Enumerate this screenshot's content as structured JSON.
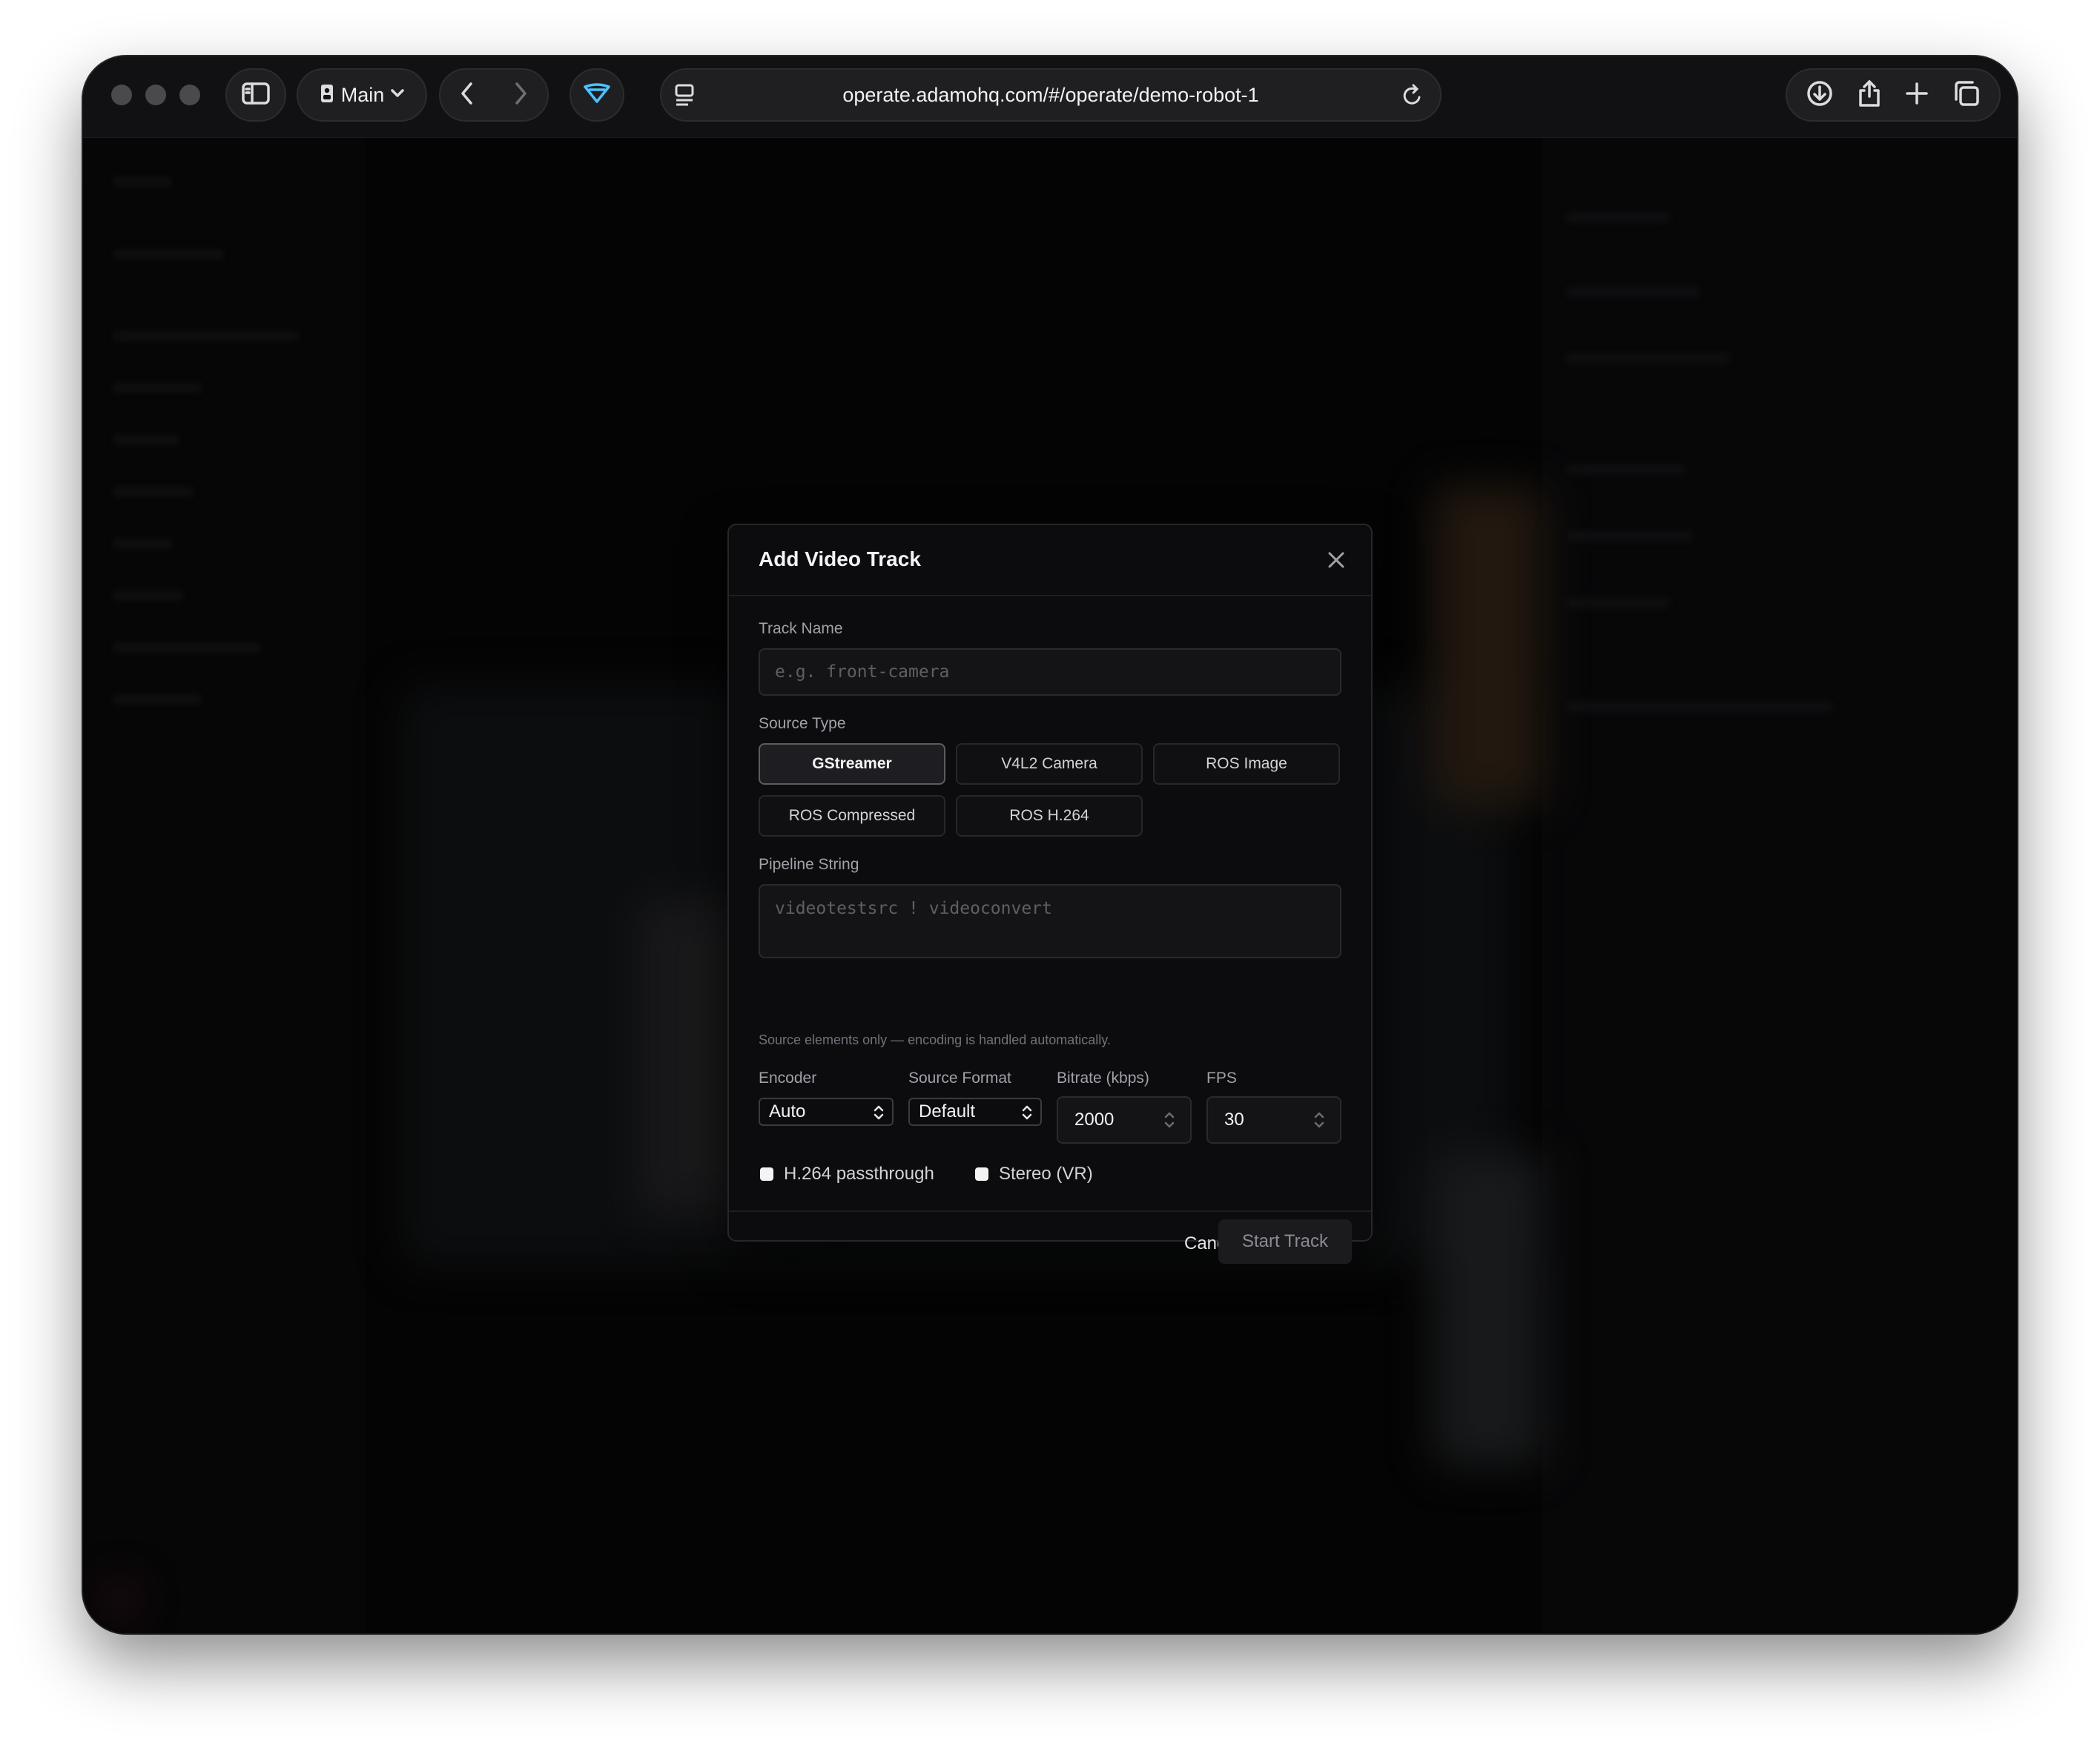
{
  "browser": {
    "profile_label": "Main",
    "url": "operate.adamohq.com/#/operate/demo-robot-1"
  },
  "modal": {
    "title": "Add Video Track",
    "track_name_label": "Track Name",
    "track_name_placeholder": "e.g. front-camera",
    "track_name_value": "",
    "source_type_label": "Source Type",
    "source_types": [
      {
        "label": "GStreamer",
        "selected": true
      },
      {
        "label": "V4L2 Camera",
        "selected": false
      },
      {
        "label": "ROS Image",
        "selected": false
      },
      {
        "label": "ROS Compressed",
        "selected": false
      },
      {
        "label": "ROS H.264",
        "selected": false
      }
    ],
    "pipeline_label": "Pipeline String",
    "pipeline_placeholder": "videotestsrc ! videoconvert",
    "pipeline_value": "",
    "pipeline_hint": "Source elements only — encoding is handled automatically.",
    "encoder_label": "Encoder",
    "encoder_value": "Auto",
    "source_format_label": "Source Format",
    "source_format_value": "Default",
    "bitrate_label": "Bitrate (kbps)",
    "bitrate_value": "2000",
    "fps_label": "FPS",
    "fps_value": "30",
    "passthrough_label": "H.264 passthrough",
    "passthrough_checked": false,
    "stereo_label": "Stereo (VR)",
    "stereo_checked": false,
    "cancel_label": "Cancel",
    "start_label": "Start Track"
  },
  "colors": {
    "background": "#000000",
    "modal_bg": "#0c0c0e",
    "accent_icon": "#4cc3ff"
  }
}
